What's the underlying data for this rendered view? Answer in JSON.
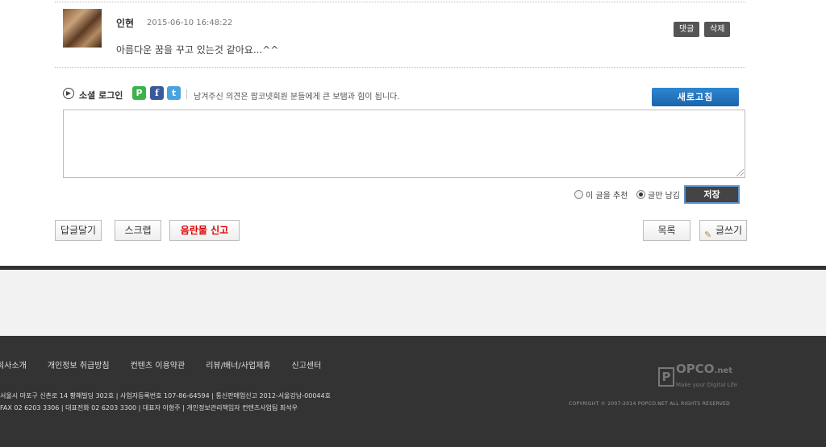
{
  "comment": {
    "author": "인현",
    "date": "2015-06-10 16:48:22",
    "text": "아름다운 꿈을 꾸고 있는것 같아요...^^",
    "reply_label": "댓글",
    "delete_label": "삭제"
  },
  "social": {
    "label": "소셜 로그인",
    "icons": [
      "naver-p-icon",
      "facebook-icon",
      "twitter-icon"
    ],
    "p_glyph": "P",
    "f_glyph": "f",
    "t_glyph": "t",
    "info": "남겨주신 의견은 팝코넷회원 분들에게 큰 보탬과 힘이 됩니다.",
    "refresh_label": "새로고침"
  },
  "editor": {
    "value": "",
    "option_recommend": "이 글을 추천",
    "option_comment_only": "글만 남김",
    "selected_option": "option_comment_only",
    "save_label": "저장"
  },
  "actions": {
    "answer_label": "답글달기",
    "scrap_label": "스크랩",
    "report_label": "음란물 신고",
    "list_label": "목록",
    "write_label": "글쓰기"
  },
  "footer": {
    "links": [
      "회사소개",
      "개인정보 취급방침",
      "컨텐츠 이용약관",
      "리뷰/배너/사업제휴",
      "신고센터"
    ],
    "address_line1": "서울시 마포구 신촌로 14 황해빌딩 302호   |   사업자등록번호 107-86-64594   |   통신판매업신고 2012-서울강남-00044호",
    "address_line2": "FAX 02 6203 3306   |   대표전화 02 6203 3300   |   대표자 이형주   |   개인정보관리책임자 컨텐츠사업팀 최석우",
    "logo_box": "P",
    "logo_text": "OPCO",
    "logo_suffix": ".net",
    "logo_tagline": "Make your Digital Life",
    "copyright": "COPYRIGHT © 2007-2014 POPCO.NET ALL RIGHTS RESERVED"
  },
  "colors": {
    "accent_blue": "#1f72be",
    "report_red": "#dd0000",
    "footer_bg": "#333333"
  }
}
